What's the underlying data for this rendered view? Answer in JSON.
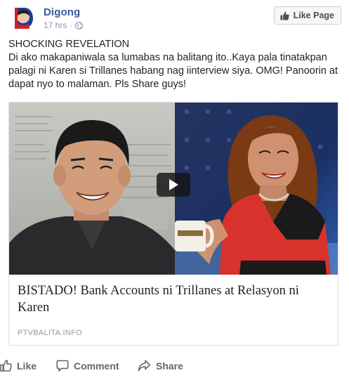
{
  "post": {
    "page_name": "Digong",
    "timestamp": "17 hrs",
    "separator": "·",
    "privacy_icon": "globe-icon",
    "like_page_label": "Like Page",
    "text_line1": "SHOCKING REVELATION",
    "text_line2": "Di ako makapaniwala sa lumabas na balitang ito..Kaya pala tinatakpan palagi ni Karen si Trillanes habang nag iinterview siya. OMG! Panoorin at dapat nyo to malaman. Pls Share guys!"
  },
  "link_card": {
    "title": "BISTADO! Bank Accounts ni Trillanes at Relasyon ni Karen",
    "domain": "PTVBALITA.INFO",
    "play_icon": "play-icon"
  },
  "actions": {
    "like_label": "Like",
    "comment_label": "Comment",
    "share_label": "Share"
  },
  "colors": {
    "link_blue": "#365899",
    "meta_gray": "#90949c",
    "action_gray": "#616770",
    "border": "#dddfe2"
  }
}
